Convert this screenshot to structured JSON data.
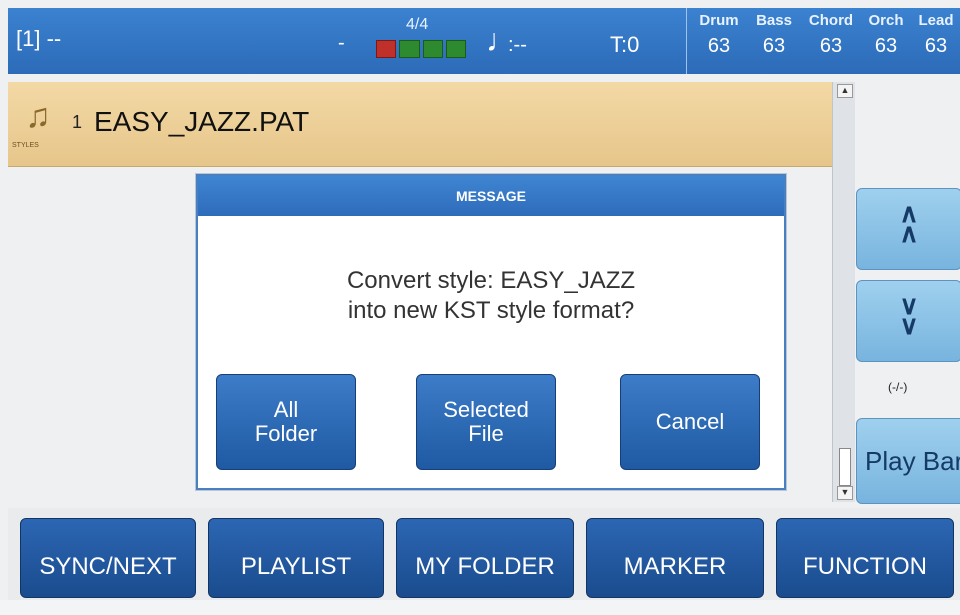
{
  "status": {
    "slot": "[1] --",
    "mid_dash": "-",
    "time_signature": "4/4",
    "beat_active": 1,
    "beat_total": 4,
    "note_glyph": "♩",
    "note_value": ":--",
    "tempo": "T:0",
    "mixer": [
      {
        "name": "Drum",
        "value": "63"
      },
      {
        "name": "Bass",
        "value": "63"
      },
      {
        "name": "Chord",
        "value": "63"
      },
      {
        "name": "Orch",
        "value": "63"
      },
      {
        "name": "Lead",
        "value": "63"
      }
    ]
  },
  "file": {
    "icon_label": "STYLES",
    "index": "1",
    "name": "EASY_JAZZ.PAT"
  },
  "side": {
    "page_up": "^ ^",
    "page_down": "v v",
    "counter": "(-/-)",
    "play_bar": "Play Bar"
  },
  "dialog": {
    "title": "MESSAGE",
    "line1": "Convert style: EASY_JAZZ",
    "line2": "into new KST style format?",
    "buttons": {
      "all_folder_1": "All",
      "all_folder_2": "Folder",
      "selected_1": "Selected",
      "selected_2": "File",
      "cancel": "Cancel"
    }
  },
  "functions": [
    "SYNC/NEXT",
    "PLAYLIST",
    "MY FOLDER",
    "MARKER",
    "FUNCTION"
  ],
  "colors": {
    "topbar": "#2c6bb8",
    "file_row": "#e6c68a",
    "button_blue": "#1f5aa3",
    "beat_on": "#c0302a",
    "beat_off": "#2e8a2e"
  }
}
